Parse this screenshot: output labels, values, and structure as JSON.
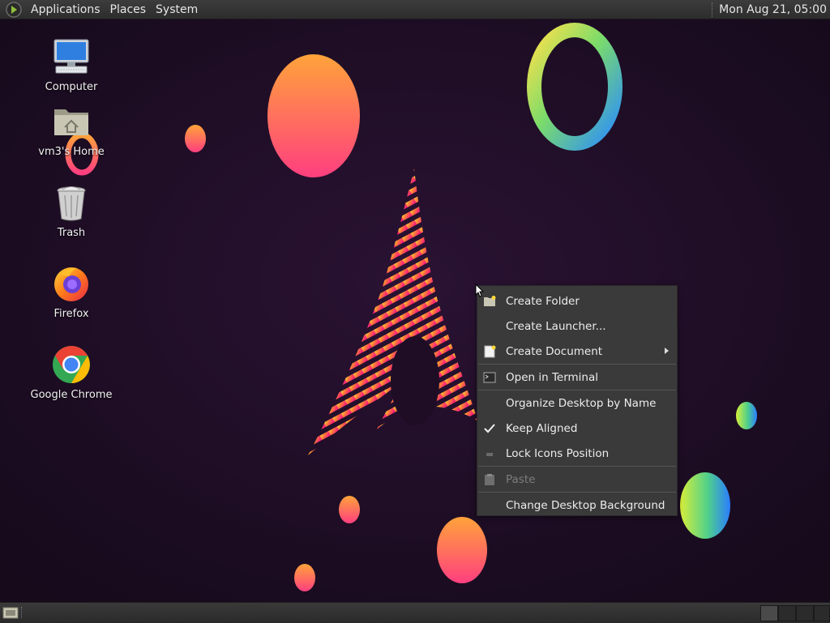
{
  "top_panel": {
    "menus": [
      "Applications",
      "Places",
      "System"
    ],
    "clock": "Mon Aug 21, 05:00",
    "logo_icon": "distro-menu-icon"
  },
  "desktop": {
    "icons": [
      {
        "label": "Computer",
        "icon": "computer-icon"
      },
      {
        "label": "vm3's Home",
        "icon": "home-folder-icon"
      },
      {
        "label": "Trash",
        "icon": "trash-icon"
      },
      {
        "label": "Firefox",
        "icon": "firefox-icon"
      },
      {
        "label": "Google Chrome",
        "icon": "chrome-icon"
      }
    ]
  },
  "context_menu": {
    "items": [
      {
        "label": "Create Folder",
        "icon": "new-folder-icon",
        "enabled": true
      },
      {
        "label": "Create Launcher...",
        "icon": "",
        "enabled": true
      },
      {
        "label": "Create Document",
        "icon": "new-document-icon",
        "enabled": true,
        "submenu": true
      },
      {
        "label": "Open in Terminal",
        "icon": "terminal-icon",
        "enabled": true
      },
      {
        "label": "Organize Desktop by Name",
        "icon": "",
        "enabled": true
      },
      {
        "label": "Keep Aligned",
        "icon": "checkmark-icon",
        "enabled": true,
        "checked": true
      },
      {
        "label": "Lock Icons Position",
        "icon": "lock-toggle-icon",
        "enabled": true
      },
      {
        "label": "Paste",
        "icon": "paste-icon",
        "enabled": false
      },
      {
        "label": "Change Desktop Background",
        "icon": "",
        "enabled": true
      }
    ]
  },
  "colors": {
    "wallpaper_bg": "#1c0f22",
    "panel_bg": "#333333",
    "menu_bg": "#3a3a3a",
    "accent_orange": "#ff8c2a",
    "accent_pink": "#ff2d7a"
  }
}
